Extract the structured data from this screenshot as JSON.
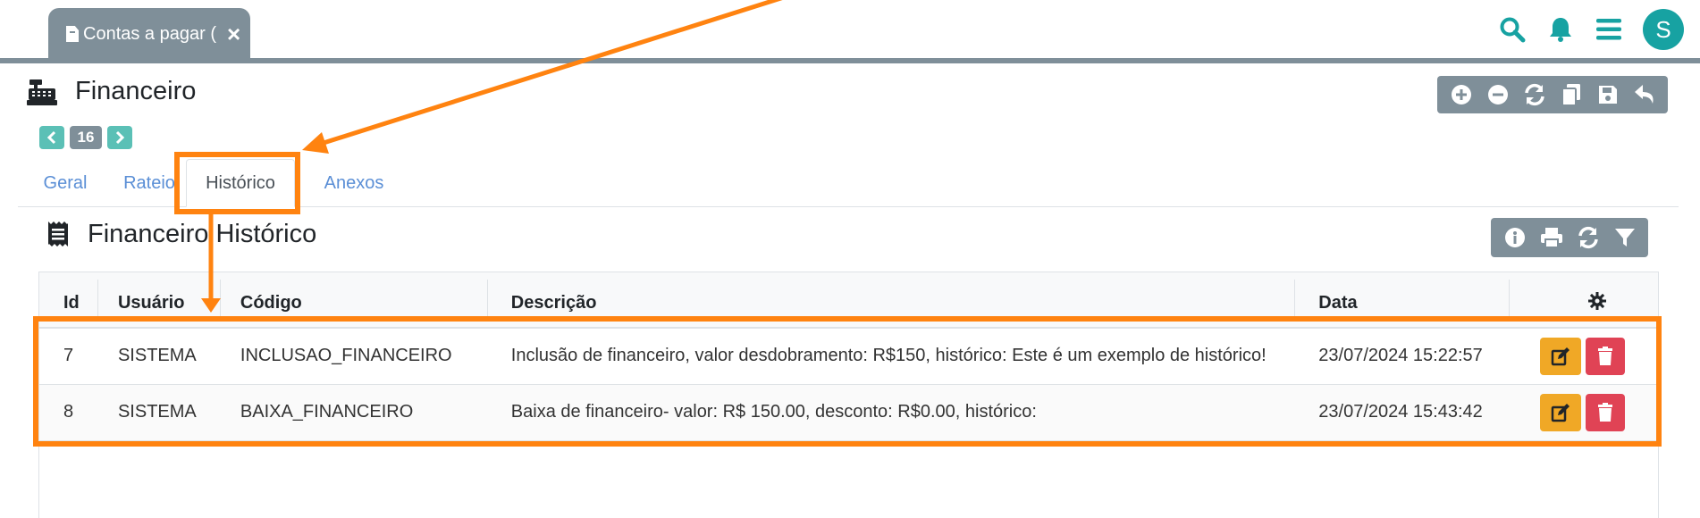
{
  "doc_tab": {
    "label": "Contas a pagar (",
    "close": "×"
  },
  "header": {
    "title": "Financeiro"
  },
  "pager": {
    "page": "16"
  },
  "tabs": [
    {
      "label": "Geral"
    },
    {
      "label": "Rateio"
    },
    {
      "label": "Histórico",
      "active": true
    },
    {
      "label": "Anexos"
    }
  ],
  "section": {
    "title": "Financeiro Histórico"
  },
  "table": {
    "columns": [
      "Id",
      "Usuário",
      "Código",
      "Descrição",
      "Data"
    ],
    "rows": [
      {
        "id": "7",
        "user": "SISTEMA",
        "code": "INCLUSAO_FINANCEIRO",
        "description": "Inclusão de financeiro, valor desdobramento: R$150, histórico: Este é um exemplo de histórico!",
        "date": "23/07/2024 15:22:57"
      },
      {
        "id": "8",
        "user": "SISTEMA",
        "code": "BAIXA_FINANCEIRO",
        "description": "Baixa de financeiro- valor: R$ 150.00, desconto: R$0.00, histórico:",
        "date": "23/07/2024 15:43:42"
      }
    ]
  },
  "user": {
    "initial": "S"
  },
  "colors": {
    "accent": "#17a2a2",
    "toolbar": "#7f8f99",
    "annotation": "#ff8310",
    "edit": "#f0a826",
    "delete": "#e04355"
  },
  "icons": [
    "file-icon",
    "close-icon",
    "search-icon",
    "bell-icon",
    "menu-icon",
    "cash-register-icon",
    "plus-circle-icon",
    "minus-circle-icon",
    "sync-icon",
    "copy-icon",
    "save-icon",
    "undo-icon",
    "chevron-left-icon",
    "chevron-right-icon",
    "receipt-icon",
    "info-icon",
    "print-icon",
    "filter-icon",
    "gear-icon",
    "edit-icon",
    "trash-icon"
  ]
}
